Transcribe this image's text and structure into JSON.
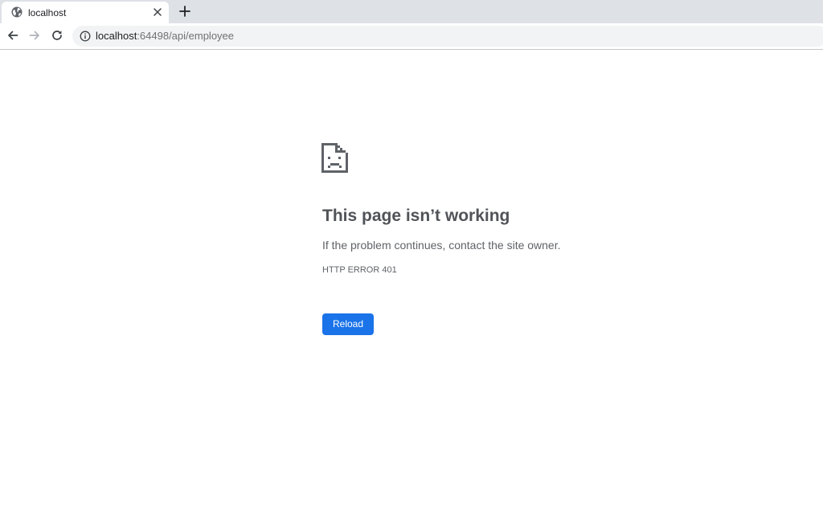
{
  "tab": {
    "title": "localhost",
    "favicon": "globe-icon",
    "close_icon": "close-icon"
  },
  "new_tab_icon": "plus-icon",
  "toolbar": {
    "back_icon": "back-arrow-icon",
    "forward_icon": "forward-arrow-icon",
    "reload_icon": "reload-icon",
    "site_info_icon": "info-icon",
    "url_host": "localhost",
    "url_rest": ":64498/api/employee"
  },
  "error": {
    "icon": "sad-document-icon",
    "title": "This page isn’t working",
    "description": "If the problem continues, contact the site owner.",
    "code": "HTTP ERROR 401",
    "reload_label": "Reload"
  },
  "colors": {
    "accent": "#1a73e8",
    "tab_strip": "#dee1e6",
    "omnibox": "#f1f3f4",
    "heading": "#505358",
    "body_text": "#5f6368"
  }
}
